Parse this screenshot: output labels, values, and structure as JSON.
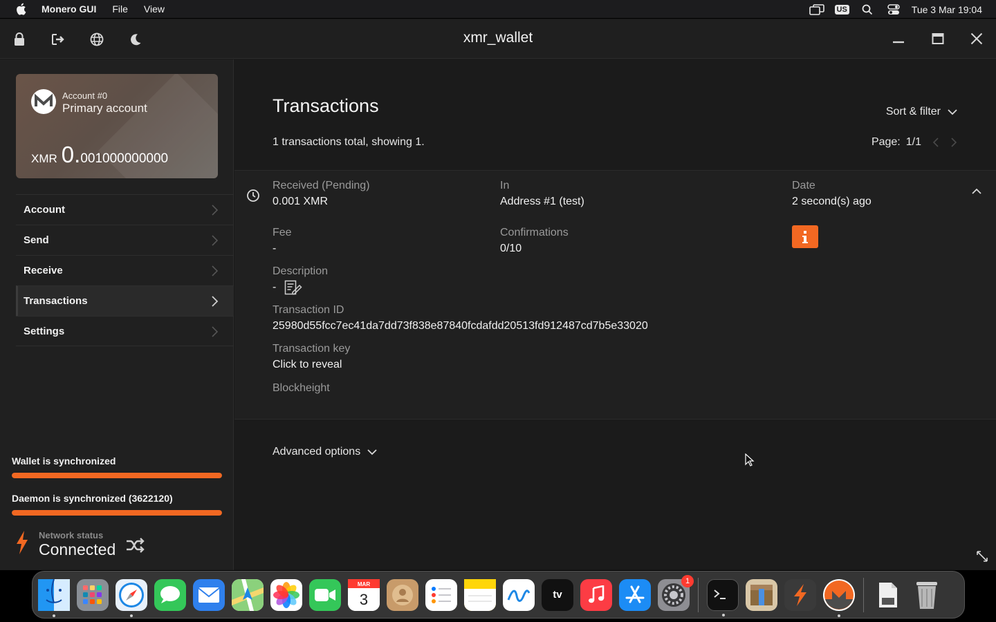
{
  "menubar": {
    "app_name": "Monero GUI",
    "menus": [
      "File",
      "View"
    ],
    "input_source": "US",
    "clock": "Tue 3 Mar  19:04"
  },
  "window": {
    "title": "xmr_wallet"
  },
  "account_card": {
    "account_number": "Account #0",
    "account_name": "Primary account",
    "currency": "XMR",
    "balance_int": "0.",
    "balance_dec": "001000000000"
  },
  "nav": {
    "items": [
      {
        "label": "Account"
      },
      {
        "label": "Send"
      },
      {
        "label": "Receive"
      },
      {
        "label": "Transactions"
      },
      {
        "label": "Settings"
      }
    ]
  },
  "sync": {
    "wallet_label": "Wallet is synchronized",
    "wallet_progress": 1.0,
    "daemon_label": "Daemon is synchronized (3622120)",
    "daemon_progress": 1.0
  },
  "network": {
    "label": "Network status",
    "value": "Connected"
  },
  "transactions": {
    "heading": "Transactions",
    "summary": "1 transactions total, showing 1.",
    "sort_filter": "Sort & filter",
    "page_label": "Page:",
    "page_value": "1/1",
    "tx": {
      "type_label": "Received (Pending)",
      "amount": "0.001 XMR",
      "in_label": "In",
      "in_value": "Address #1 (test)",
      "date_label": "Date",
      "date_value": "2 second(s) ago",
      "fee_label": "Fee",
      "fee_value": "-",
      "confirmations_label": "Confirmations",
      "confirmations_value": "0/10",
      "description_label": "Description",
      "description_value": "-",
      "txid_label": "Transaction ID",
      "txid_value": "25980d55fcc7ec41da7dd73f838e87840fcdafdd20513fd912487cd7b5e33020",
      "txkey_label": "Transaction key",
      "txkey_value": "Click to reveal",
      "blockheight_label": "Blockheight"
    },
    "advanced_options": "Advanced options"
  },
  "accent_color": "#f26822",
  "dock": {
    "apps": [
      {
        "name": "finder-icon",
        "color": "#1e88e5"
      },
      {
        "name": "launchpad-icon",
        "color": "#9aa0a6"
      },
      {
        "name": "safari-icon",
        "color": "#1976d2"
      },
      {
        "name": "messages-icon",
        "color": "#34c759"
      },
      {
        "name": "mail-icon",
        "color": "#2f80ed"
      },
      {
        "name": "maps-icon",
        "color": "#5ac05a"
      },
      {
        "name": "photos-icon",
        "color": "#f0f0f0"
      },
      {
        "name": "facetime-icon",
        "color": "#34c759"
      },
      {
        "name": "calendar-icon",
        "color": "#ffffff"
      },
      {
        "name": "contacts-icon",
        "color": "#c89b6a"
      },
      {
        "name": "reminders-icon",
        "color": "#ffffff"
      },
      {
        "name": "notes-icon",
        "color": "#ffd60a"
      },
      {
        "name": "freeform-icon",
        "color": "#ffffff"
      },
      {
        "name": "apple-tv-icon",
        "color": "#111111"
      },
      {
        "name": "music-icon",
        "color": "#fc3c44"
      },
      {
        "name": "app-store-icon",
        "color": "#1c8cf5"
      },
      {
        "name": "system-settings-icon",
        "color": "#8e8e93"
      },
      {
        "name": "terminal-icon",
        "color": "#111111"
      },
      {
        "name": "archive-utility-icon",
        "color": "#6b8fb5"
      },
      {
        "name": "tor-icon",
        "color": "#3a3a3a"
      },
      {
        "name": "monero-icon",
        "color": "#ffffff"
      },
      {
        "name": "document-icon",
        "color": "#e8e8e8"
      },
      {
        "name": "trash-icon",
        "color": "#9a9a9a"
      }
    ],
    "calendar_month": "MAR",
    "calendar_day": "3",
    "tv_label": "tv",
    "settings_badge": "1"
  }
}
